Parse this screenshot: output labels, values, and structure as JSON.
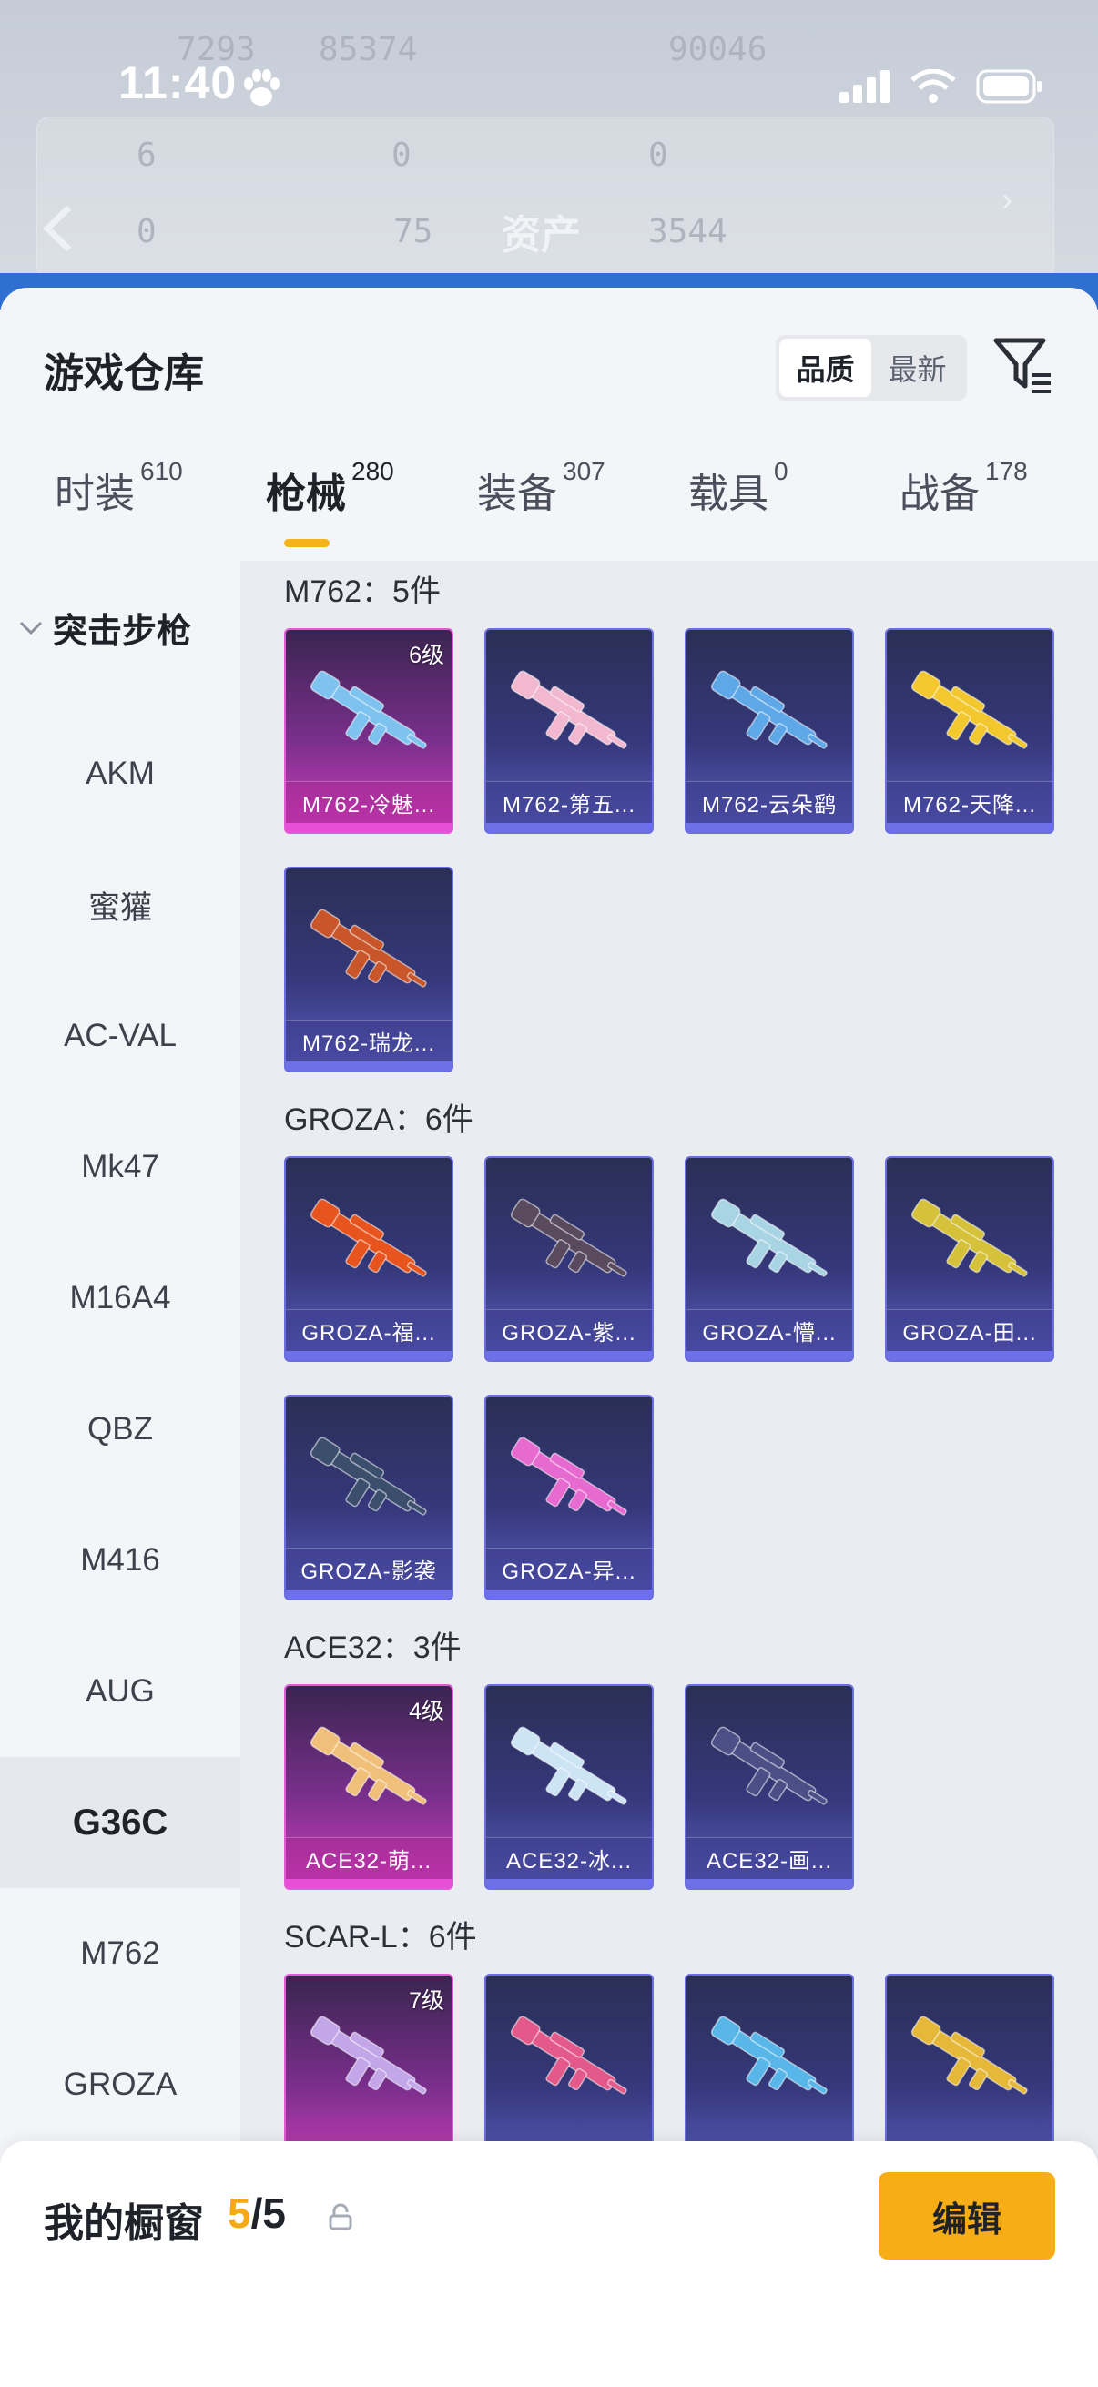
{
  "status_bar": {
    "time": "11:40"
  },
  "background_page": {
    "title": "资产",
    "stats": [
      "7293",
      "85374",
      "90046",
      "6",
      "0",
      "0",
      "0",
      "75",
      "3544"
    ]
  },
  "warehouse": {
    "title": "游戏仓库",
    "sort_options": [
      "品质",
      "最新"
    ],
    "sort_selected": "品质",
    "tabs": [
      {
        "label": "时装",
        "count": "610"
      },
      {
        "label": "枪械",
        "count": "280"
      },
      {
        "label": "装备",
        "count": "307"
      },
      {
        "label": "载具",
        "count": "0"
      },
      {
        "label": "战备",
        "count": "178"
      }
    ],
    "active_tab": "枪械"
  },
  "sidebar": {
    "category": "突击步枪",
    "items": [
      "AKM",
      "蜜獾",
      "AC-VAL",
      "Mk47",
      "M16A4",
      "QBZ",
      "M416",
      "AUG",
      "G36C",
      "M762",
      "GROZA"
    ],
    "active_item": "G36C"
  },
  "groups": [
    {
      "title": "M762：5件",
      "cards": [
        {
          "label": "M762-冷魅...",
          "level": "6级",
          "quality": "pink",
          "color": "#7ec3f0"
        },
        {
          "label": "M762-第五...",
          "level": "",
          "quality": "purple",
          "color": "#f2b8cf"
        },
        {
          "label": "M762-云朵鹞",
          "level": "",
          "quality": "purple",
          "color": "#5fa8e8"
        },
        {
          "label": "M762-天降...",
          "level": "",
          "quality": "purple",
          "color": "#f2c82e"
        },
        {
          "label": "M762-瑞龙...",
          "level": "",
          "quality": "purple",
          "color": "#c8562a"
        }
      ]
    },
    {
      "title": "GROZA：6件",
      "cards": [
        {
          "label": "GROZA-福...",
          "level": "",
          "quality": "purple",
          "color": "#e8541e"
        },
        {
          "label": "GROZA-紫...",
          "level": "",
          "quality": "purple",
          "color": "#5a4a5e"
        },
        {
          "label": "GROZA-懵...",
          "level": "",
          "quality": "purple",
          "color": "#a9d4e4"
        },
        {
          "label": "GROZA-田...",
          "level": "",
          "quality": "purple",
          "color": "#d6c23a"
        },
        {
          "label": "GROZA-影袭",
          "level": "",
          "quality": "purple",
          "color": "#3b4e6c"
        },
        {
          "label": "GROZA-异...",
          "level": "",
          "quality": "purple",
          "color": "#e66ad0"
        }
      ]
    },
    {
      "title": "ACE32：3件",
      "cards": [
        {
          "label": "ACE32-萌...",
          "level": "4级",
          "quality": "pink",
          "color": "#f0c07a"
        },
        {
          "label": "ACE32-冰...",
          "level": "",
          "quality": "purple",
          "color": "#cde4f5"
        },
        {
          "label": "ACE32-画...",
          "level": "",
          "quality": "purple",
          "color": "#4b4f86"
        }
      ]
    },
    {
      "title": "SCAR-L：6件",
      "cards": [
        {
          "label": "",
          "level": "7级",
          "quality": "pink",
          "color": "#c2a6e8"
        },
        {
          "label": "",
          "level": "",
          "quality": "purple",
          "color": "#e35a8a"
        },
        {
          "label": "",
          "level": "",
          "quality": "purple",
          "color": "#58b6e8"
        },
        {
          "label": "",
          "level": "",
          "quality": "purple",
          "color": "#e6b83a"
        }
      ]
    }
  ],
  "bottom_bar": {
    "label": "我的橱窗",
    "count_current": "5",
    "count_sep": "/",
    "count_total": "5",
    "edit_label": "编辑"
  },
  "colors": {
    "accent": "#f7ad16",
    "card_purple": "#6b6ee0",
    "card_pink": "#e45ad6"
  }
}
